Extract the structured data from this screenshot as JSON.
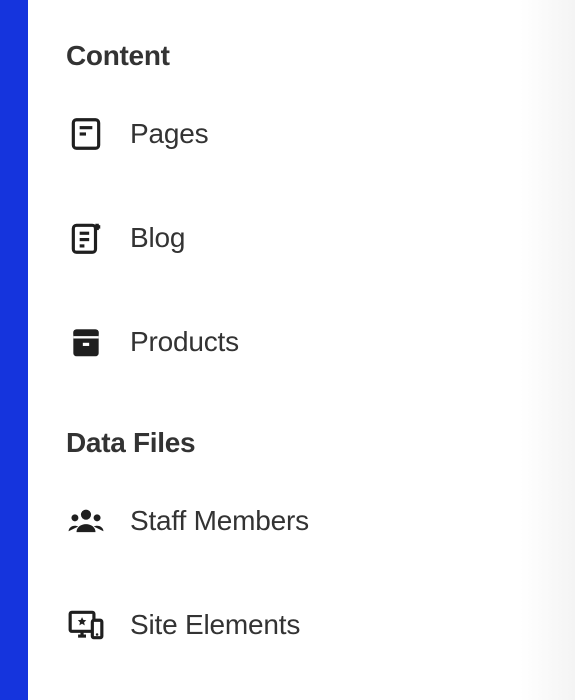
{
  "sidebar": {
    "sections": [
      {
        "heading": "Content",
        "items": [
          {
            "label": "Pages",
            "icon": "page-icon"
          },
          {
            "label": "Blog",
            "icon": "blog-icon"
          },
          {
            "label": "Products",
            "icon": "products-icon"
          }
        ]
      },
      {
        "heading": "Data Files",
        "items": [
          {
            "label": "Staff Members",
            "icon": "staff-icon"
          },
          {
            "label": "Site Elements",
            "icon": "site-elements-icon"
          }
        ]
      }
    ]
  }
}
